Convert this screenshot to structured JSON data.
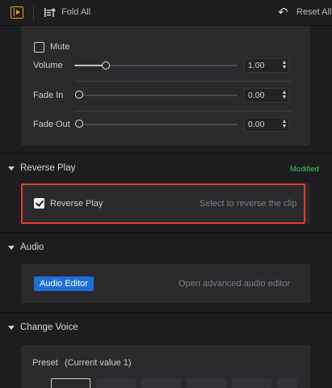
{
  "toolbar": {
    "panel_icon": "panel-toggle-icon",
    "fold_all_icon": "fold-all-icon",
    "fold_all_label": "Fold All",
    "reset_icon": "undo-icon",
    "reset_all_label": "Reset All"
  },
  "audio_params": {
    "mute_label": "Mute",
    "mute_checked": false,
    "volume": {
      "label": "Volume",
      "value": "1.00",
      "level": 0.2
    },
    "fade_in": {
      "label": "Fade In",
      "value": "0.00",
      "level": 0
    },
    "fade_out": {
      "label": "Fade Out",
      "value": "0.00",
      "level": 0
    }
  },
  "reverse_play": {
    "section_title": "Reverse Play",
    "status": "Modified",
    "checkbox_label": "Reverse Play",
    "checked": true,
    "hint": "Select to reverse the clip"
  },
  "audio": {
    "section_title": "Audio",
    "button_label": "Audio Editor",
    "hint": "Open advanced audio editor"
  },
  "change_voice": {
    "section_title": "Change Voice",
    "preset_label": "Preset",
    "current_value": "(Current value 1)"
  },
  "colors": {
    "accent": "#1e6ed8",
    "modified": "#3cc870",
    "highlight": "#e03b32",
    "panel_icon": "#f0a020"
  }
}
